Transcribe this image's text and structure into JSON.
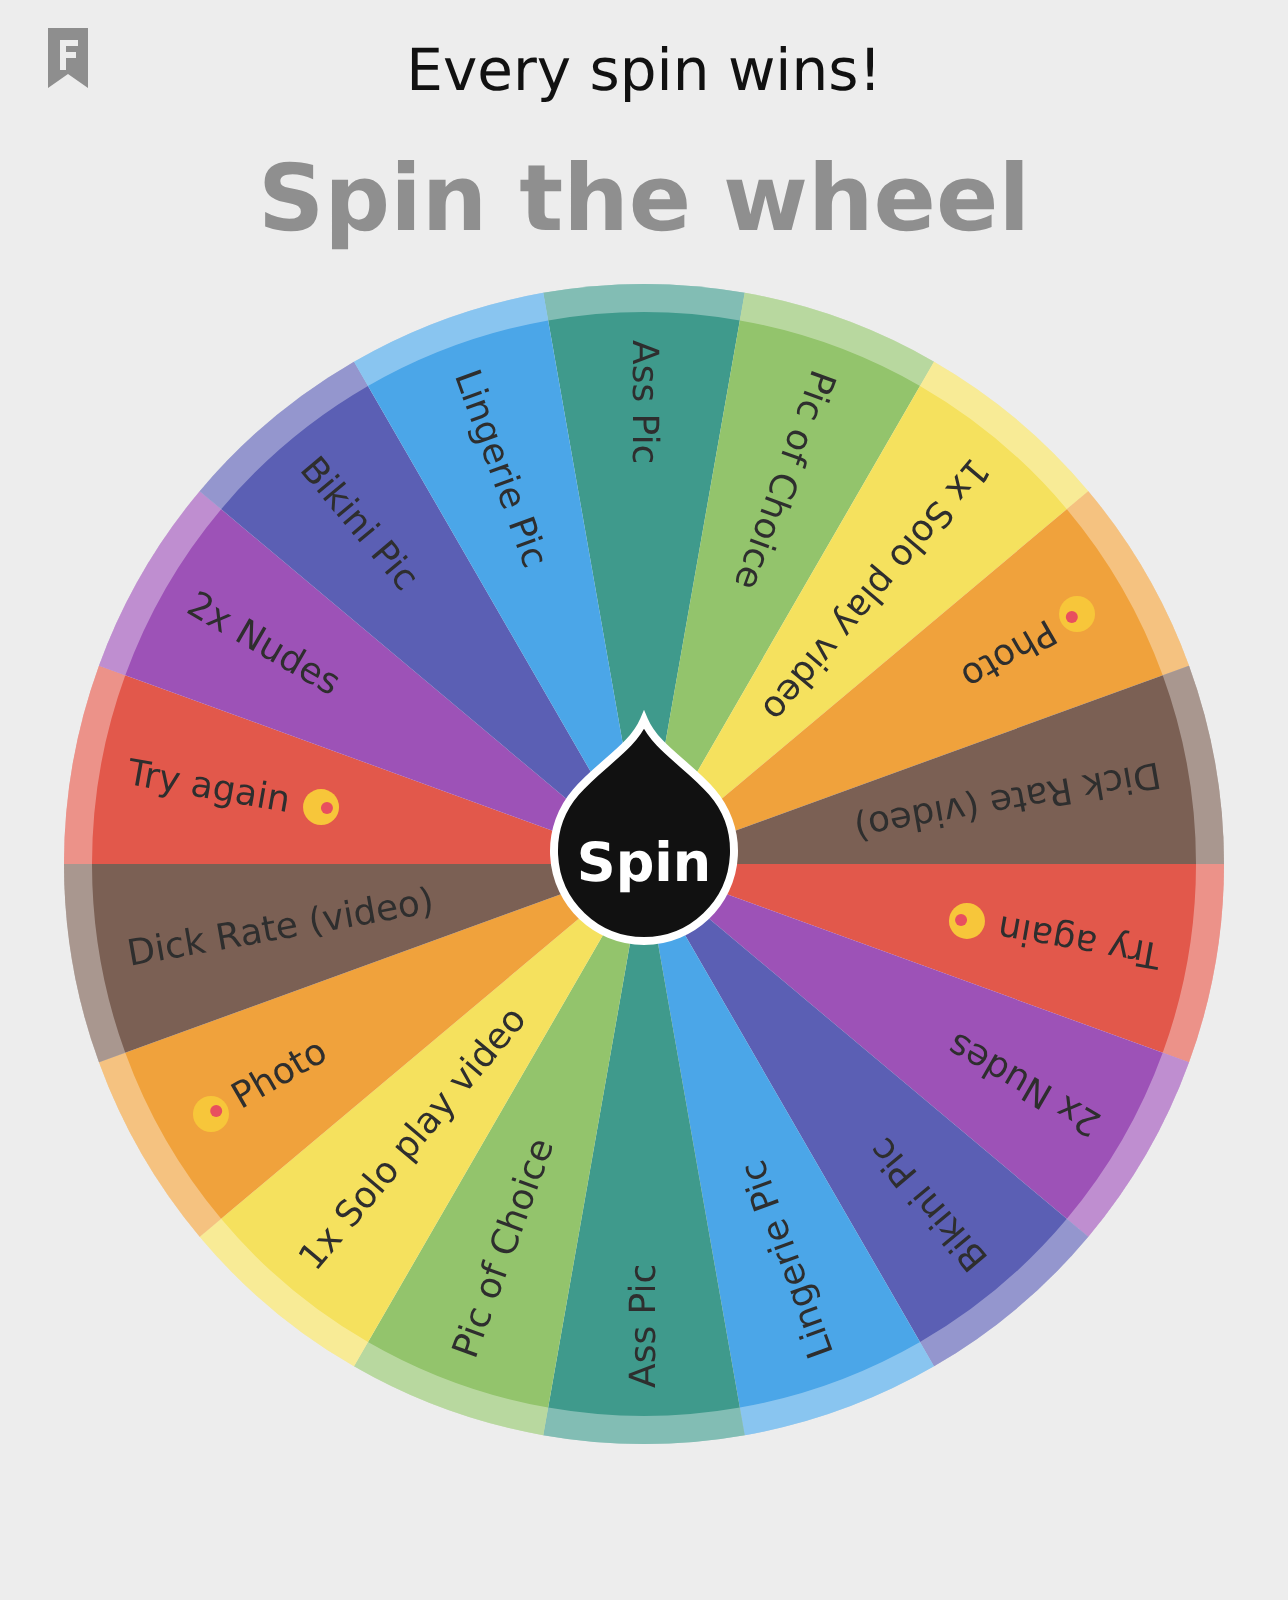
{
  "header": {
    "title": "Every spin wins!",
    "heading": "Spin the wheel"
  },
  "wheel": {
    "button": "Spin",
    "segments": [
      {
        "label": "Ass Pic",
        "color": "#3f9a8c",
        "kind": "plain"
      },
      {
        "label": "Pic of Choice",
        "color": "#93c46c",
        "kind": "plain"
      },
      {
        "label": "1x Solo play video",
        "color": "#f5e15e",
        "kind": "plain"
      },
      {
        "label": "Photo",
        "color": "#f0a23c",
        "kind": "leading"
      },
      {
        "label": "Dick Rate (video)",
        "color": "#7b6054",
        "kind": "plain"
      },
      {
        "label": "Try again",
        "color": "#e2584b",
        "kind": "trailing"
      },
      {
        "label": "2x Nudes",
        "color": "#9d52b7",
        "kind": "plain"
      },
      {
        "label": "Bikini Pic",
        "color": "#5b5fb4",
        "kind": "plain"
      },
      {
        "label": "Lingerie Pic",
        "color": "#4ba6e8",
        "kind": "plain"
      },
      {
        "label": "Ass Pic",
        "color": "#3f9a8c",
        "kind": "plain"
      },
      {
        "label": "Pic of Choice",
        "color": "#93c46c",
        "kind": "plain"
      },
      {
        "label": "1x Solo play video",
        "color": "#f5e15e",
        "kind": "plain"
      },
      {
        "label": "Photo",
        "color": "#f0a23c",
        "kind": "leading"
      },
      {
        "label": "Dick Rate (video)",
        "color": "#7b6054",
        "kind": "plain"
      },
      {
        "label": "Try again",
        "color": "#e2584b",
        "kind": "trailing"
      },
      {
        "label": "2x Nudes",
        "color": "#9d52b7",
        "kind": "plain"
      },
      {
        "label": "Bikini Pic",
        "color": "#5b5fb4",
        "kind": "plain"
      },
      {
        "label": "Lingerie Pic",
        "color": "#4ba6e8",
        "kind": "plain"
      }
    ]
  }
}
